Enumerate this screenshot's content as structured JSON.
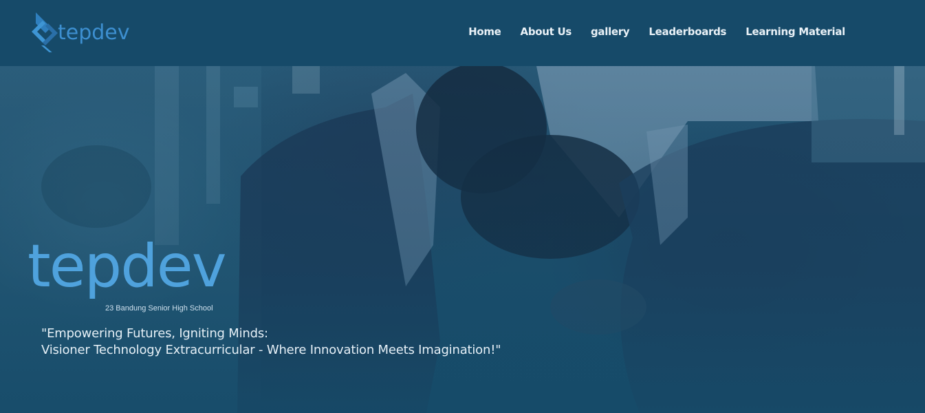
{
  "brand": {
    "logo_text": "tepdev",
    "icon": "diamond-tp-logo-icon"
  },
  "nav": {
    "items": [
      "Home",
      "About Us",
      "gallery",
      "Leaderboards",
      "Learning Material"
    ]
  },
  "hero": {
    "logo_word": "tepdev",
    "school": "23 Bandung Senior High School",
    "quote_line1": "\"Empowering Futures, Igniting Minds:",
    "quote_line2": "Visioner Technology Extracurricular - Where Innovation Meets Imagination!\"",
    "background": "students-photo"
  },
  "colors": {
    "header": "#164a69",
    "accent": "#3d8fd0",
    "overlay": "#164b69"
  }
}
